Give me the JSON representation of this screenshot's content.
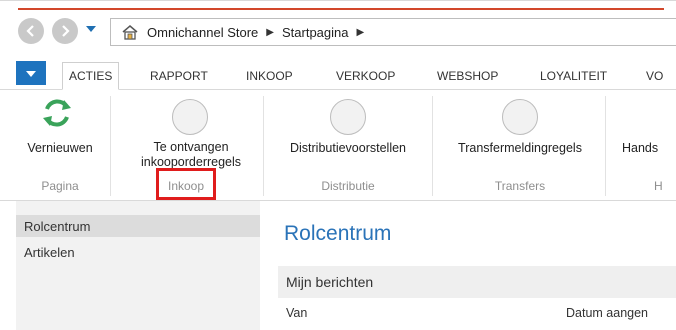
{
  "address": {
    "breadcrumb": [
      "Omnichannel Store",
      "Startpagina"
    ]
  },
  "tabs": [
    "ACTIES",
    "RAPPORT",
    "INKOOP",
    "VERKOOP",
    "WEBSHOP",
    "LOYALITEIT",
    "VO"
  ],
  "ribbon": {
    "buttons": {
      "refresh": "Vernieuwen",
      "receive_line1": "Te ontvangen",
      "receive_line2": "inkooporderregels",
      "distribution": "Distributievoorstellen",
      "transfer": "Transfermeldingregels",
      "hands": "Hands"
    },
    "groups": {
      "pagina": "Pagina",
      "inkoop": "Inkoop",
      "distributie": "Distributie",
      "transfers": "Transfers",
      "h": "H"
    }
  },
  "sidebar": {
    "items": [
      "Rolcentrum",
      "Artikelen"
    ]
  },
  "main": {
    "title": "Rolcentrum",
    "panel_title": "Mijn berichten",
    "columns": [
      "Van",
      "Datum aangen"
    ]
  },
  "colors": {
    "accent": "#1e73be",
    "highlight": "#e01c1c",
    "refresh_icon": "#3aa35a"
  }
}
